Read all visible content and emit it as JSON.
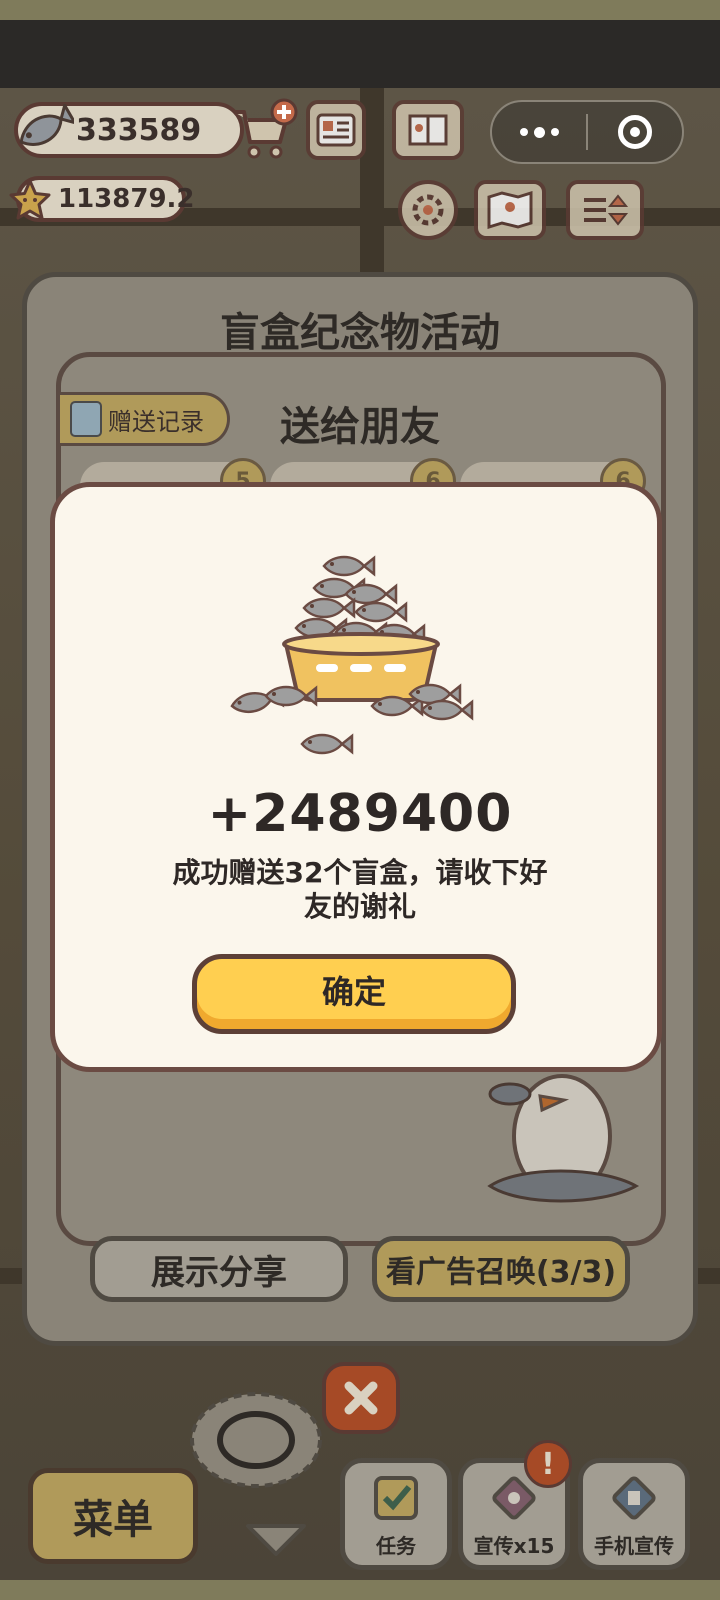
{
  "hud": {
    "fish_count": "333589",
    "star_count": "113879.2"
  },
  "event": {
    "title": "盲盒纪念物活动",
    "gift_title": "送给朋友",
    "record_label": "赠送记录",
    "slot_badges": [
      "5",
      "6",
      "6"
    ],
    "share_label": "展示分享",
    "ad_label": "看广告召唤(3/3)"
  },
  "dialog": {
    "amount": "+2489400",
    "message": "成功赠送32个盲盒，请收下好友的谢礼",
    "confirm_label": "确定"
  },
  "bottom": {
    "menu_label": "菜单",
    "task_label": "任务",
    "promo_label": "宣传x15",
    "phone_promo_label": "手机宣传",
    "alert_mark": "!"
  },
  "colors": {
    "accent_yellow": "#ffcf50",
    "dialog_bg": "#fbf6ec",
    "border_brown": "#6b4b43",
    "fish_gray": "#9e9e9e"
  }
}
